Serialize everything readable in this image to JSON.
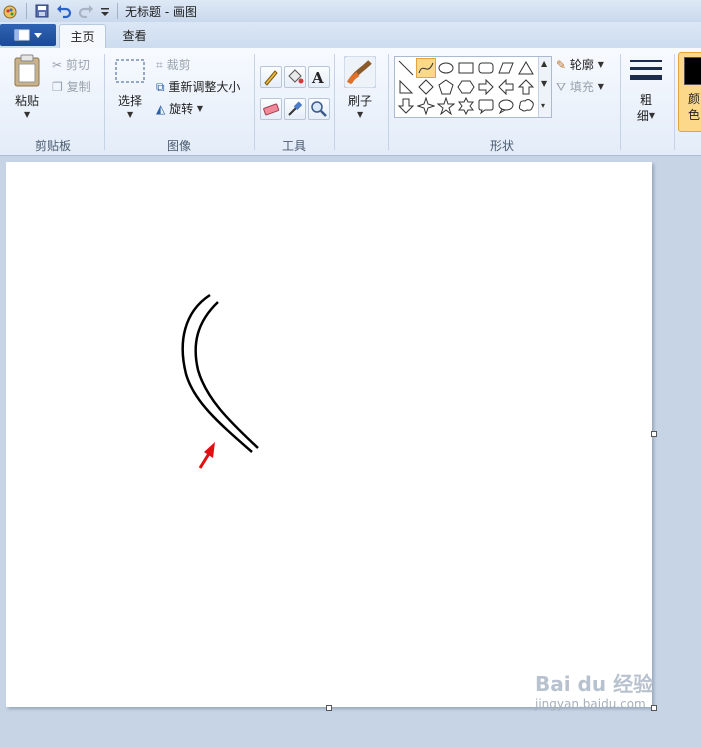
{
  "window": {
    "title": "无标题 - 画图"
  },
  "tabs": [
    {
      "label": "主页",
      "active": true
    },
    {
      "label": "查看",
      "active": false
    }
  ],
  "clipboard": {
    "paste": "粘贴",
    "cut": "剪切",
    "copy": "复制",
    "group": "剪贴板"
  },
  "image": {
    "select": "选择",
    "crop": "裁剪",
    "resize": "重新调整大小",
    "rotate": "旋转",
    "group": "图像"
  },
  "tools": {
    "group": "工具"
  },
  "brushes": {
    "label": "刷子"
  },
  "shapes": {
    "outline": "轮廓",
    "fill": "填充",
    "group": "形状"
  },
  "size": {
    "label_top": "粗",
    "label_bottom": "细"
  },
  "color": {
    "label_top": "颜",
    "label_bottom": "色",
    "current": "#000000"
  },
  "watermark": {
    "brand": "Bai du 经验",
    "url": "jingyan.baidu.com"
  },
  "colors": {
    "accent": "#e8a33a",
    "annotation_arrow": "#e01010"
  }
}
